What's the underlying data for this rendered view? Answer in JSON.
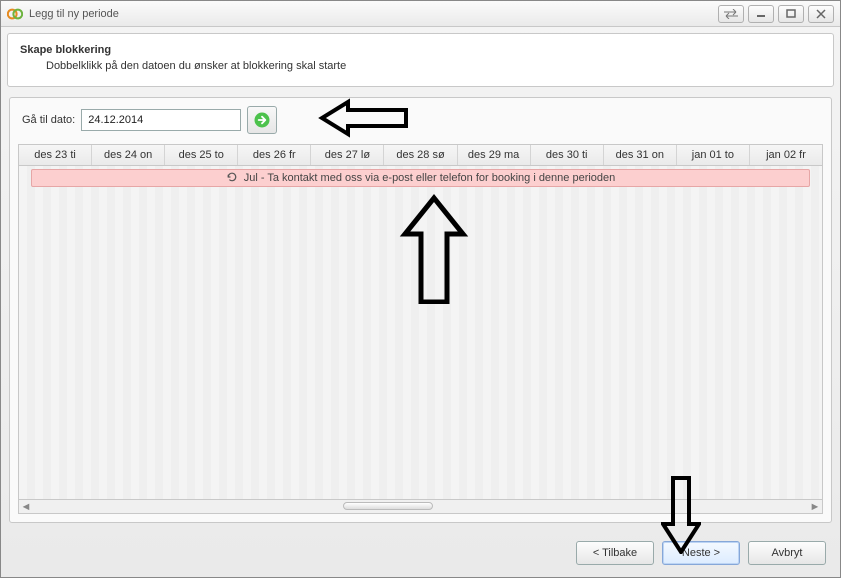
{
  "window": {
    "title": "Legg til ny periode"
  },
  "header": {
    "title": "Skape blokkering",
    "subtitle": "Dobbelklikk på den datoen du ønsker at blokkering skal starte"
  },
  "goto": {
    "label": "Gå til dato:",
    "value": "24.12.2014"
  },
  "calendar": {
    "columns": [
      "des 23 ti",
      "des 24 on",
      "des 25 to",
      "des 26 fr",
      "des 27 lø",
      "des 28 sø",
      "des 29 ma",
      "des 30 ti",
      "des 31 on",
      "jan 01 to",
      "jan 02 fr"
    ],
    "banner": "Jul - Ta kontakt med oss via e-post eller telefon for booking i denne perioden"
  },
  "footer": {
    "back": "< Tilbake",
    "next": "Neste >",
    "cancel": "Avbryt"
  }
}
